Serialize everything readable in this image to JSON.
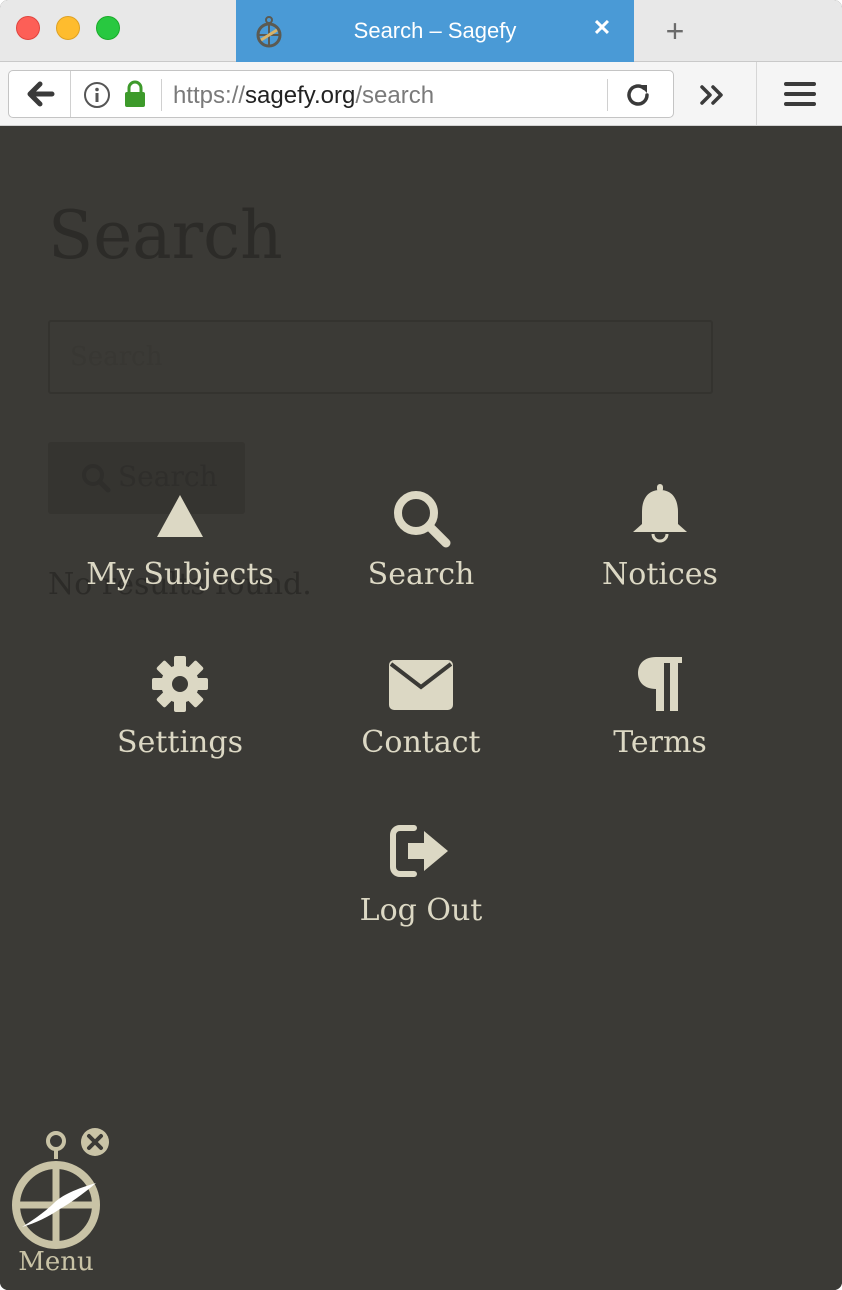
{
  "browser": {
    "tab_title": "Search – Sagefy",
    "tab_close": "✕",
    "new_tab": "+",
    "url_scheme": "https://",
    "url_host": "sagefy.org",
    "url_path": "/search",
    "accent_color": "#4a9ad6"
  },
  "page": {
    "title": "Search",
    "search_placeholder": "Search",
    "search_button_label": "Search",
    "no_results": "No results found."
  },
  "menu": {
    "items": [
      {
        "label": "My Subjects",
        "icon": "triangle-up-icon"
      },
      {
        "label": "Search",
        "icon": "search-icon"
      },
      {
        "label": "Notices",
        "icon": "bell-icon"
      },
      {
        "label": "Settings",
        "icon": "gear-icon"
      },
      {
        "label": "Contact",
        "icon": "envelope-icon"
      },
      {
        "label": "Terms",
        "icon": "pilcrow-icon"
      },
      {
        "label": "Log Out",
        "icon": "sign-out-icon"
      }
    ],
    "toggle_label": "Menu",
    "icon_color": "#dcd8c4"
  }
}
